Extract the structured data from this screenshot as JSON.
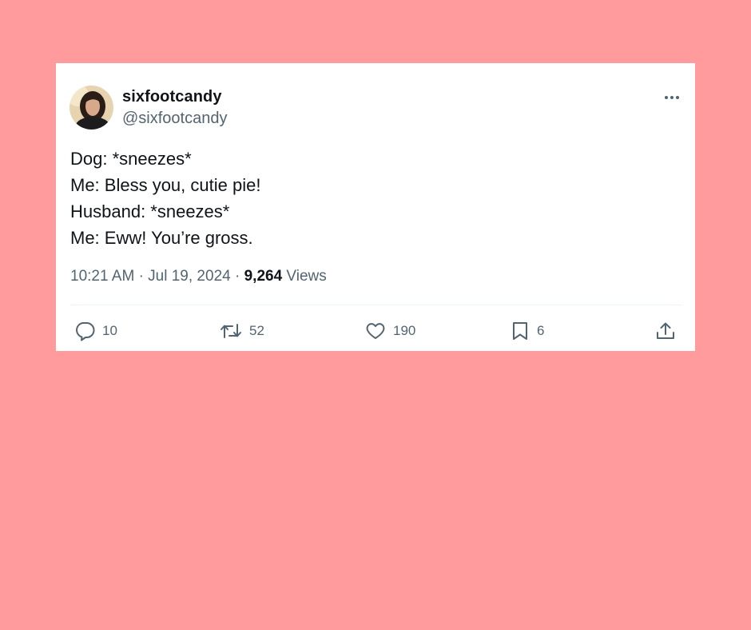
{
  "tweet": {
    "display_name": "sixfootcandy",
    "handle": "@sixfootcandy",
    "lines": [
      "Dog: *sneezes*",
      "Me: Bless you, cutie pie!",
      "Husband: *sneezes*",
      "Me: Eww! You’re gross."
    ],
    "time": "10:21 AM",
    "date": "Jul 19, 2024",
    "separator": "·",
    "views_count": "9,264",
    "views_label": "Views"
  },
  "actions": {
    "replies": "10",
    "retweets": "52",
    "likes": "190",
    "bookmarks": "6"
  },
  "icons": {
    "more": "more-horizontal-icon",
    "reply": "reply-icon",
    "retweet": "retweet-icon",
    "like": "heart-icon",
    "bookmark": "bookmark-icon",
    "share": "share-icon"
  },
  "colors": {
    "background": "#ff9b9c",
    "card": "#ffffff",
    "text_primary": "#0f1419",
    "text_secondary": "#536471",
    "divider": "#eff3f4"
  }
}
